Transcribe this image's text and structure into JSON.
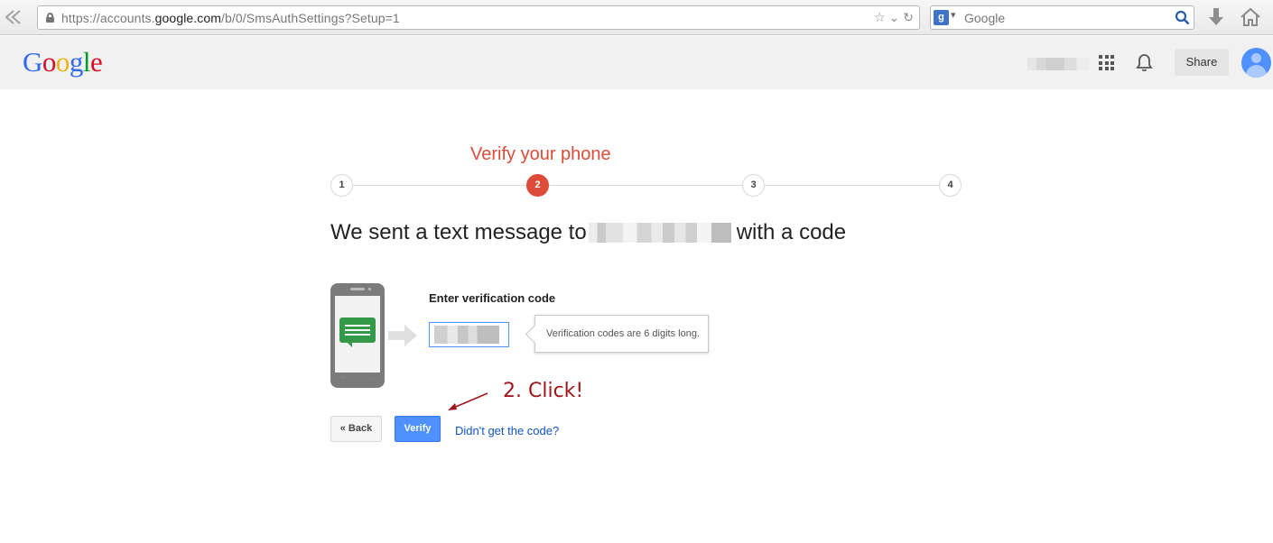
{
  "browser": {
    "url_prefix": "https://accounts.",
    "url_domain": "google.com",
    "url_suffix": "/b/0/SmsAuthSettings?Setup=1",
    "search_placeholder": "Google"
  },
  "header": {
    "logo_letters": [
      "G",
      "o",
      "o",
      "g",
      "l",
      "e"
    ],
    "logo_colors": [
      "#3369e8",
      "#d50f25",
      "#eeb211",
      "#3369e8",
      "#009925",
      "#d50f25"
    ],
    "share_label": "Share"
  },
  "stepper": {
    "title": "Verify your phone",
    "steps": [
      "1",
      "2",
      "3",
      "4"
    ],
    "active_step": "2",
    "accent_color": "#dd4b39"
  },
  "main": {
    "headline_before": "We sent a text message to",
    "headline_after": "with a code",
    "code_label": "Enter verification code",
    "tooltip": "Verification codes are 6 digits long.",
    "annotation": "2. Click!",
    "back_label": "« Back",
    "verify_label": "Verify",
    "resend_link": "Didn't get the code?"
  }
}
